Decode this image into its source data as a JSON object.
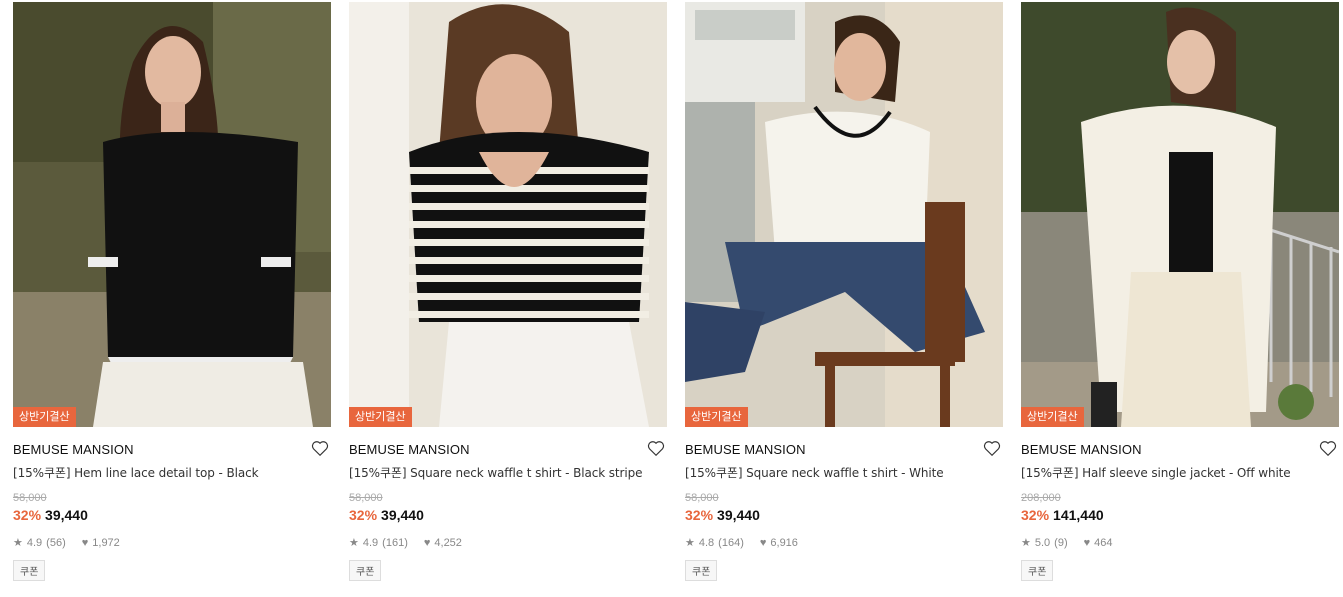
{
  "products": [
    {
      "badge": "상반기결산",
      "brand": "BEMUSE MANSION",
      "title": "[15%쿠폰] Hem line lace detail top - Black",
      "original_price": "58,000",
      "discount": "32%",
      "price": "39,440",
      "rating": "4.9",
      "reviews": "(56)",
      "likes": "1,972",
      "tag": "쿠폰"
    },
    {
      "badge": "상반기결산",
      "brand": "BEMUSE MANSION",
      "title": "[15%쿠폰] Square neck waffle t shirt - Black stripe",
      "original_price": "58,000",
      "discount": "32%",
      "price": "39,440",
      "rating": "4.9",
      "reviews": "(161)",
      "likes": "4,252",
      "tag": "쿠폰"
    },
    {
      "badge": "상반기결산",
      "brand": "BEMUSE MANSION",
      "title": "[15%쿠폰] Square neck waffle t shirt - White",
      "original_price": "58,000",
      "discount": "32%",
      "price": "39,440",
      "rating": "4.8",
      "reviews": "(164)",
      "likes": "6,916",
      "tag": "쿠폰"
    },
    {
      "badge": "상반기결산",
      "brand": "BEMUSE MANSION",
      "title": "[15%쿠폰] Half sleeve single jacket - Off white",
      "original_price": "208,000",
      "discount": "32%",
      "price": "141,440",
      "rating": "5.0",
      "reviews": "(9)",
      "likes": "464",
      "tag": "쿠폰"
    }
  ],
  "colors": {
    "badge_bg": "#e8663d",
    "discount": "#e8663d"
  },
  "icons": {
    "wishlist": "heart-outline-icon",
    "rating": "star-icon",
    "likes": "heart-filled-icon"
  }
}
